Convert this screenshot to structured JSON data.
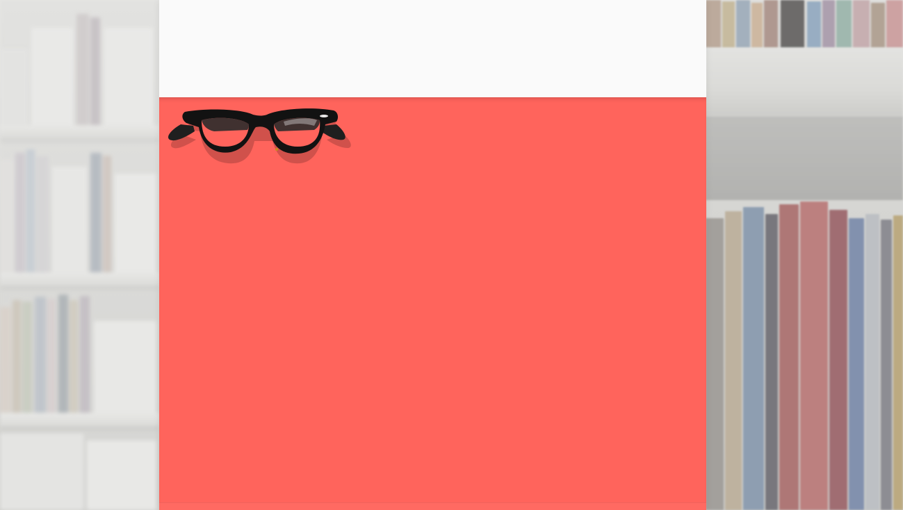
{
  "page": {
    "title": ""
  },
  "background": {
    "icon": "library-bookshelves"
  },
  "panel": {
    "header_color": "#fafafa",
    "body_color": "#ff645c"
  },
  "logo": {
    "icon": "eyeglasses-icon"
  }
}
